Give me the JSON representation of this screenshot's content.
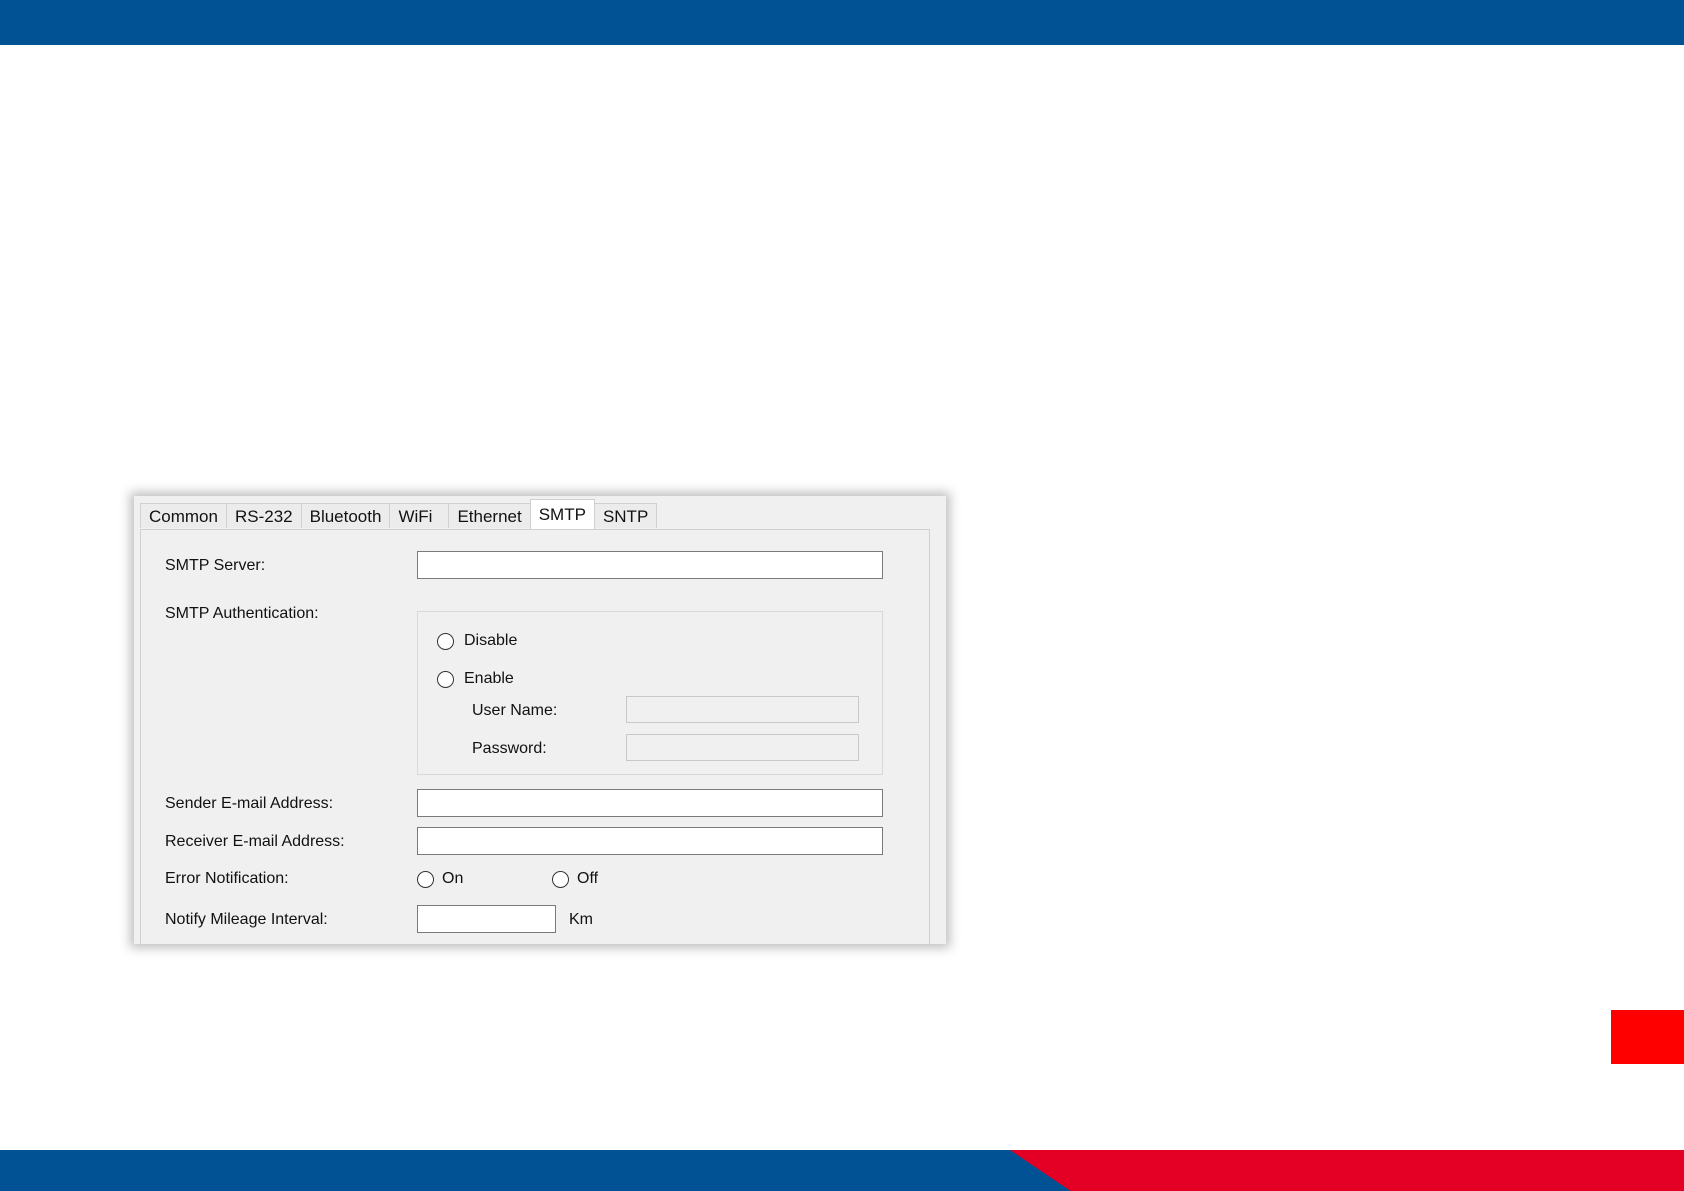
{
  "tabs": [
    "Common",
    "RS-232",
    "Bluetooth",
    "WiFi",
    "Ethernet",
    "SMTP",
    "SNTP"
  ],
  "active_tab": "SMTP",
  "form": {
    "smtp_server_label": "SMTP Server:",
    "smtp_server_value": "",
    "smtp_auth_label": "SMTP Authentication:",
    "auth_disable_label": "Disable",
    "auth_enable_label": "Enable",
    "user_name_label": "User Name:",
    "user_name_value": "",
    "password_label": "Password:",
    "password_value": "",
    "sender_label": "Sender E-mail Address:",
    "sender_value": "",
    "receiver_label": "Receiver E-mail Address:",
    "receiver_value": "",
    "error_notification_label": "Error Notification:",
    "on_label": "On",
    "off_label": "Off",
    "mileage_label": "Notify Mileage Interval:",
    "mileage_value": "",
    "mileage_unit": "Km"
  },
  "colors": {
    "band_blue": "#005294",
    "band_red": "#e40025",
    "side_tab_red": "#ff0000"
  }
}
